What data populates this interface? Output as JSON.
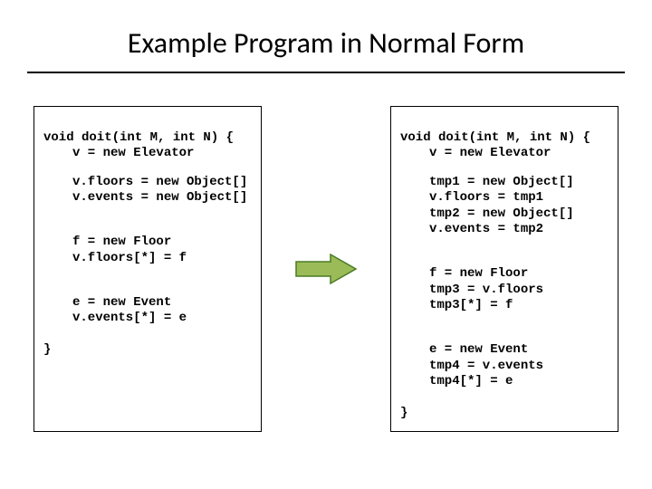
{
  "title": "Example Program in Normal Form",
  "left": {
    "sig": "void doit(int M, int N) {",
    "l1": "v = new Elevator",
    "b1a": "v.floors = new Object[]",
    "b1b": "v.events = new Object[]",
    "b2a": "f = new Floor",
    "b2b": "v.floors[*] = f",
    "b3a": "e = new Event",
    "b3b": "v.events[*] = e",
    "close": "}"
  },
  "right": {
    "sig": "void doit(int M, int N) {",
    "l1": "v = new Elevator",
    "b1a": "tmp1 = new Object[]",
    "b1b": "v.floors = tmp1",
    "b1c": "tmp2 = new Object[]",
    "b1d": "v.events = tmp2",
    "b2a": "f = new Floor",
    "b2b": "tmp3 = v.floors",
    "b2c": "tmp3[*] = f",
    "b3a": "e = new Event",
    "b3b": "tmp4 = v.events",
    "b3c": "tmp4[*] = e",
    "close": "}"
  }
}
